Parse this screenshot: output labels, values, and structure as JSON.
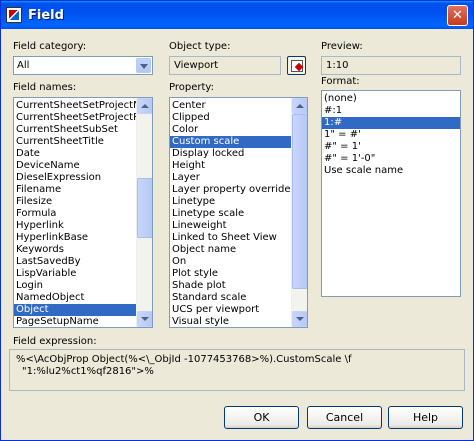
{
  "window": {
    "title": "Field"
  },
  "field_category": {
    "label": "Field category:",
    "value": "All"
  },
  "field_names": {
    "label": "Field names:",
    "items": [
      "CurrentSheetSetProjectNu",
      "CurrentSheetSetProjectPh",
      "CurrentSheetSubSet",
      "CurrentSheetTitle",
      "Date",
      "DeviceName",
      "DieselExpression",
      "Filename",
      "Filesize",
      "Formula",
      "Hyperlink",
      "HyperlinkBase",
      "Keywords",
      "LastSavedBy",
      "LispVariable",
      "Login",
      "NamedObject",
      "Object",
      "PageSetupName"
    ],
    "selected": "Object"
  },
  "object_type": {
    "label": "Object type:",
    "value": "Viewport",
    "pick_button_icon": "select-object-icon"
  },
  "property": {
    "label": "Property:",
    "items": [
      "Center",
      "Clipped",
      "Color",
      "Custom scale",
      "Display locked",
      "Height",
      "Layer",
      "Layer property overrides",
      "Linetype",
      "Linetype scale",
      "Lineweight",
      "Linked to Sheet View",
      "Object name",
      "On",
      "Plot style",
      "Shade plot",
      "Standard scale",
      "UCS per viewport",
      "Visual style"
    ],
    "selected": "Custom scale"
  },
  "preview": {
    "label": "Preview:",
    "value": "1:10"
  },
  "format": {
    "label": "Format:",
    "items": [
      "(none)",
      "#:1",
      "1:#",
      "1\" = #'",
      "#\" = 1'",
      "#\" = 1'-0\"",
      "Use scale name"
    ],
    "selected": "1:#"
  },
  "field_expression": {
    "label": "Field expression:",
    "line1": "%<\\AcObjProp Object(%<\\_ObjId -1077453768>%).CustomScale \\f",
    "line2": "\"1:%lu2%ct1%qf2816\">%"
  },
  "buttons": {
    "ok": "OK",
    "cancel": "Cancel",
    "help": "Help"
  },
  "colors": {
    "titlebar": "#0054e3",
    "selection": "#316ac5",
    "dialog_bg": "#ece9d8"
  }
}
